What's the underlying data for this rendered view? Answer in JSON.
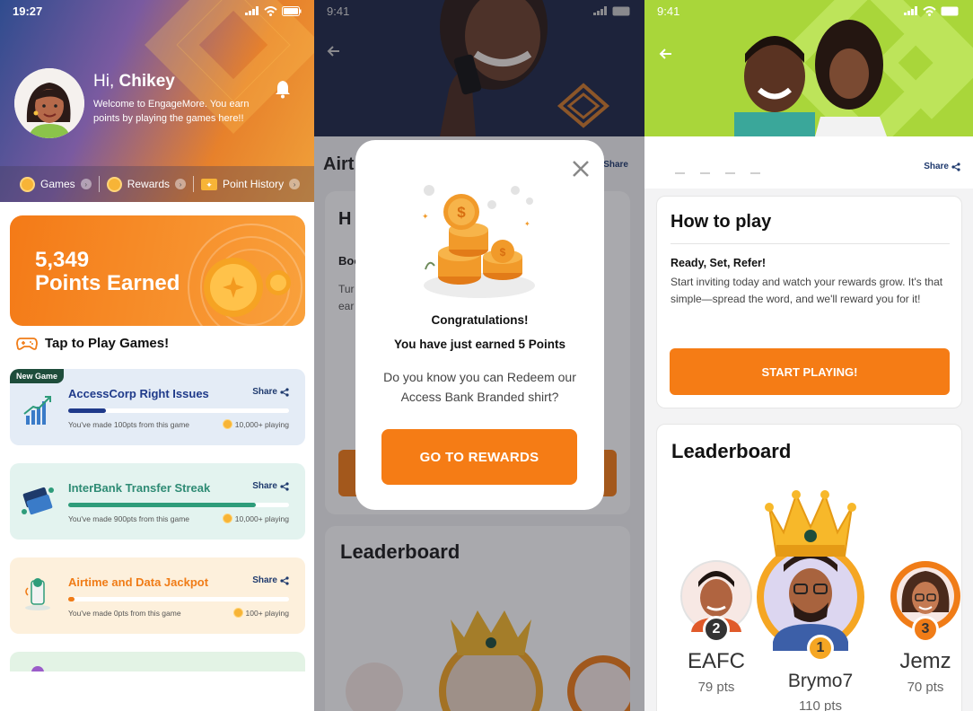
{
  "screen1": {
    "status_time": "19:27",
    "greeting_prefix": "Hi,",
    "user_name": "Chikey",
    "welcome_text": "Welcome to EngageMore. You earn points by playing the games here!!",
    "nav": [
      {
        "label": "Games"
      },
      {
        "label": "Rewards"
      },
      {
        "label": "Point History"
      }
    ],
    "points_value": "5,349",
    "points_label": "Points Earned",
    "tap_to_play": "Tap to Play Games!",
    "share_label": "Share",
    "new_game_badge": "New Game",
    "games": [
      {
        "title": "AccessCorp Right Issues",
        "made": "You've made 100pts from this  game",
        "playing": "10,000+ playing",
        "progress": 0.17,
        "title_color": "#1f3a8a",
        "fill_color": "#1f3a8a",
        "bg": "#e4ecf6"
      },
      {
        "title": "InterBank Transfer Streak",
        "made": "You've made 900pts from this  game",
        "playing": "10,000+ playing",
        "progress": 0.85,
        "title_color": "#2e8b74",
        "fill_color": "#2e9c7a",
        "bg": "#e3f3ef"
      },
      {
        "title": "Airtime and Data Jackpot",
        "made": "You've made 0pts from this  game",
        "playing": "100+ playing",
        "progress": 0.03,
        "title_color": "#f07c17",
        "fill_color": "#f07c17",
        "bg": "#fdf0dc"
      }
    ]
  },
  "screen2": {
    "status_time": "9:41",
    "behind_title": "Airt",
    "behind_share": "Share",
    "behind_heading": "H",
    "behind_sub": "Boo",
    "behind_text": "Tur\near",
    "behind_leaderboard": "Leaderboard",
    "modal": {
      "congrats": "Congratulations!",
      "earned": "You have just earned 5 Points",
      "question": "Do you know you can Redeem our Access Bank Branded shirt?",
      "button": "GO TO REWARDS"
    }
  },
  "screen3": {
    "status_time": "9:41",
    "share_label": "Share",
    "how_to_play": {
      "title": "How to play",
      "subtitle": "Ready, Set, Refer!",
      "text": "Start inviting today and watch your rewards grow. It's that simple—spread the word, and we'll reward you for it!",
      "button": "START PLAYING!"
    },
    "leaderboard": {
      "title": "Leaderboard",
      "entries": [
        {
          "rank": "2",
          "name": "EAFC",
          "points": "79 pts"
        },
        {
          "rank": "1",
          "name": "Brymo7",
          "points": "110 pts"
        },
        {
          "rank": "3",
          "name": "Jemz",
          "points": "70 pts"
        }
      ]
    }
  },
  "colors": {
    "accent_orange": "#f57c15",
    "navy": "#1f3a6e",
    "hero_green": "#a9d63a"
  }
}
